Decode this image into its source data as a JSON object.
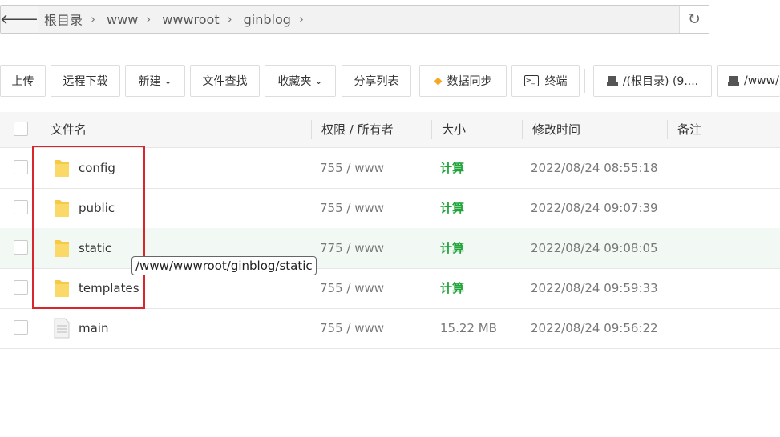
{
  "path_bar": {
    "back_icon": "arrow-left-icon",
    "crumbs": [
      "根目录",
      "www",
      "wwwroot",
      "ginblog"
    ],
    "refresh_icon": "refresh-icon"
  },
  "toolbar": {
    "upload": "上传",
    "remote_download": "远程下载",
    "new": "新建",
    "file_search": "文件查找",
    "favorites": "收藏夹",
    "share_list": "分享列表",
    "data_sync": "数据同步",
    "terminal": "终端",
    "disk_root": "/(根目录) (9....",
    "disk_www": "/www/"
  },
  "table": {
    "headers": {
      "name": "文件名",
      "perm": "权限 / 所有者",
      "size": "大小",
      "modified": "修改时间",
      "note": "备注"
    },
    "rows": [
      {
        "name": "config",
        "type": "folder",
        "perm": "755 / www",
        "size": "计算",
        "modified": "2022/08/24 08:55:18"
      },
      {
        "name": "public",
        "type": "folder",
        "perm": "755 / www",
        "size": "计算",
        "modified": "2022/08/24 09:07:39"
      },
      {
        "name": "static",
        "type": "folder",
        "perm": "775 / www",
        "size": "计算",
        "modified": "2022/08/24 09:08:05"
      },
      {
        "name": "templates",
        "type": "folder",
        "perm": "755 / www",
        "size": "计算",
        "modified": "2022/08/24 09:59:33"
      },
      {
        "name": "main",
        "type": "file",
        "perm": "755 / www",
        "size": "15.22 MB",
        "modified": "2022/08/24 09:56:22"
      }
    ]
  },
  "tooltip": "/www/wwwroot/ginblog/static",
  "colors": {
    "accent_green": "#20a53a",
    "highlight_red": "#d9262c",
    "folder_yellow": "#f7c948"
  }
}
